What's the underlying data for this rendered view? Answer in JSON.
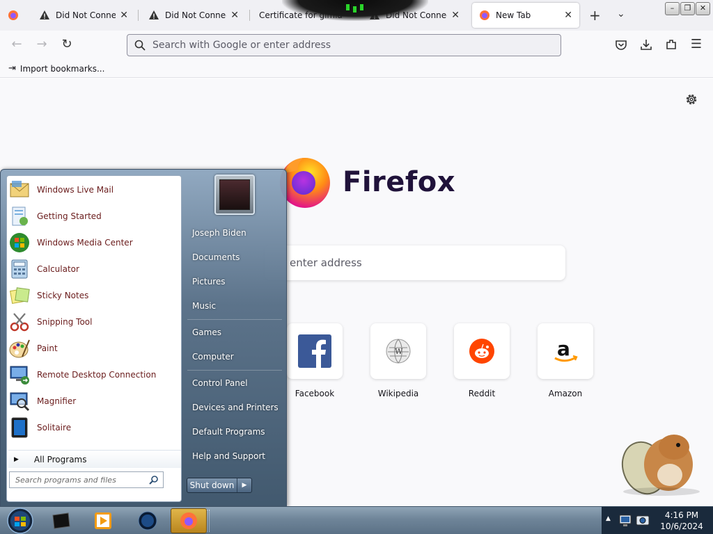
{
  "browser": {
    "tabs": [
      {
        "label": "Did Not Connect: P",
        "icon": "warning-icon"
      },
      {
        "label": "Did Not Connect: P",
        "icon": "warning-icon"
      },
      {
        "label": "Certificate for gimla",
        "icon": "none"
      },
      {
        "label": "Did Not Connect: P",
        "icon": "warning-icon"
      },
      {
        "label": "New Tab",
        "icon": "firefox-icon",
        "active": true
      }
    ],
    "url_placeholder": "Search with Google or enter address",
    "bookmark_import": "Import bookmarks..."
  },
  "newtab": {
    "brand": "Firefox",
    "search_placeholder": "enter address",
    "shortcuts": [
      {
        "name": "Facebook"
      },
      {
        "name": "Wikipedia"
      },
      {
        "name": "Reddit"
      },
      {
        "name": "Amazon"
      }
    ]
  },
  "startmenu": {
    "programs": [
      {
        "label": "Windows Live Mail",
        "icon": "mail-icon"
      },
      {
        "label": "Getting Started",
        "icon": "getting-started-icon"
      },
      {
        "label": "Windows Media Center",
        "icon": "media-center-icon"
      },
      {
        "label": "Calculator",
        "icon": "calculator-icon"
      },
      {
        "label": "Sticky Notes",
        "icon": "sticky-notes-icon"
      },
      {
        "label": "Snipping Tool",
        "icon": "snipping-tool-icon"
      },
      {
        "label": "Paint",
        "icon": "paint-icon"
      },
      {
        "label": "Remote Desktop Connection",
        "icon": "remote-desktop-icon"
      },
      {
        "label": "Magnifier",
        "icon": "magnifier-icon"
      },
      {
        "label": "Solitaire",
        "icon": "solitaire-icon"
      }
    ],
    "all_programs": "All Programs",
    "search_placeholder": "Search programs and files",
    "right_links": [
      "Joseph Biden",
      "Documents",
      "Pictures",
      "Music",
      "Games",
      "Computer",
      "Control Panel",
      "Devices and Printers",
      "Default Programs",
      "Help and Support"
    ],
    "shutdown": "Shut down"
  },
  "taskbar": {
    "time": "4:16 PM",
    "date": "10/6/2024"
  }
}
